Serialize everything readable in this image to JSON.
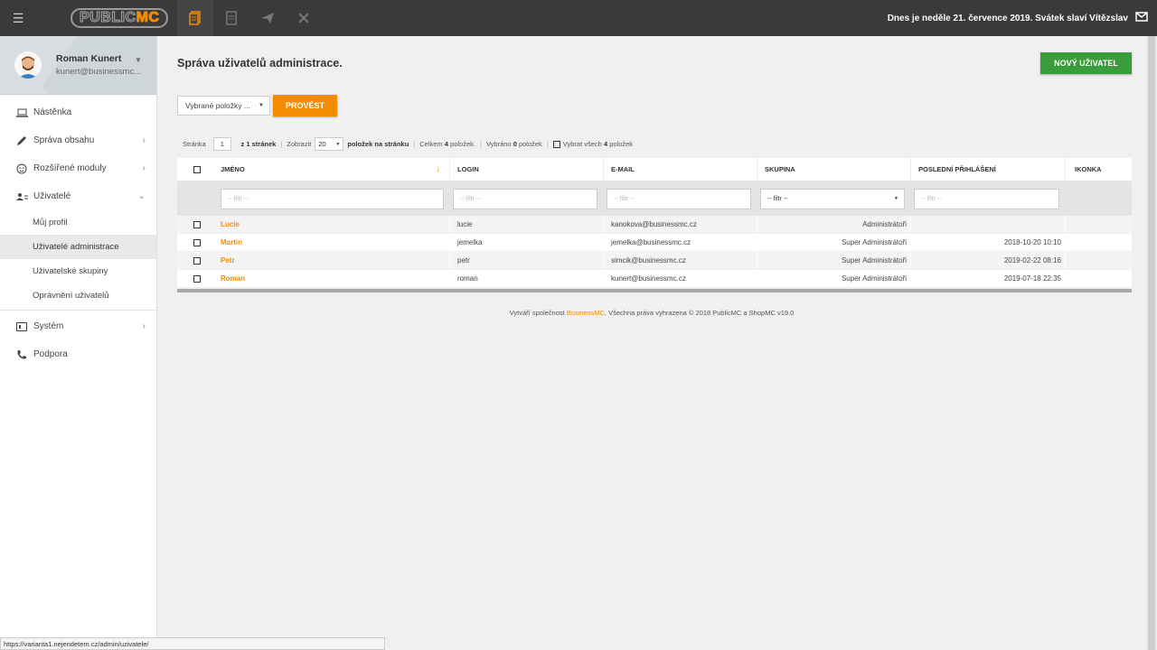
{
  "topbar": {
    "logo_left": "PUBLIC",
    "logo_right": "MC",
    "date_text": "Dnes je neděle 21. července 2019. Svátek slaví Vítězslav",
    "icons": [
      "menu-icon",
      "pages-icon",
      "document-icon",
      "send-icon",
      "tools-icon",
      "mail-icon"
    ]
  },
  "user": {
    "name": "Roman Kunert",
    "email": "kunert@businessmc..."
  },
  "sidebar": {
    "items": [
      {
        "label": "Nástěnka"
      },
      {
        "label": "Správa obsahu"
      },
      {
        "label": "Rozšířené moduly"
      },
      {
        "label": "Uživatelé"
      },
      {
        "label": "Systém"
      },
      {
        "label": "Podpora"
      }
    ],
    "subitems": [
      {
        "label": "Můj profil"
      },
      {
        "label": "Uživatelé administrace"
      },
      {
        "label": "Uživatelské skupiny"
      },
      {
        "label": "Oprávnění uživatelů"
      }
    ]
  },
  "main": {
    "title": "Správa uživatelů administrace.",
    "new_user_label": "NOVÝ UŽIVATEL",
    "bulk_select": "Vybrané položky ...",
    "run_label": "PROVÉST"
  },
  "pager": {
    "page_label": "Stránka",
    "page_value": "1",
    "of_pages": "z 1 stránek",
    "show_label": "Zobrazit",
    "per_page": "20",
    "per_page_suffix": "položek na stránku",
    "total_prefix": "Celkem",
    "total_count": "4",
    "total_suffix": "položek.",
    "selected_prefix": "Vybráno",
    "selected_count": "0",
    "selected_suffix": "položek",
    "select_all_prefix": "Vybrat všech",
    "select_all_count": "4",
    "select_all_suffix": "položek"
  },
  "table": {
    "headers": [
      "JMÉNO",
      "LOGIN",
      "E-MAIL",
      "SKUPINA",
      "POSLEDNÍ PŘIHLÁŠENÍ",
      "IKONKA"
    ],
    "filter_placeholder": "-- filtr --",
    "filter_select": "-- filtr --",
    "rows": [
      {
        "name": "Lucie",
        "login": "lucie",
        "email": "kanokova@businessmc.cz",
        "group": "Administrátoři",
        "last_login": ""
      },
      {
        "name": "Martin",
        "login": "jemelka",
        "email": "jemelka@businessmc.cz",
        "group": "Super Administrátoři",
        "last_login": "2018-10-20 10:10"
      },
      {
        "name": "Petr",
        "login": "petr",
        "email": "simcik@businessmc.cz",
        "group": "Super Administrátoři",
        "last_login": "2019-02-22 08:16"
      },
      {
        "name": "Roman",
        "login": "roman",
        "email": "kunert@businessmc.cz",
        "group": "Super Administrátoři",
        "last_login": "2019-07-18 22:35"
      }
    ]
  },
  "footer": {
    "prefix": "Vytváří společnost",
    "brand": "BusinessMC",
    "suffix": ". Všechna práva vyhrazena © 2018 PublicMC a ShopMC v19.0"
  },
  "status_url": "https://varianta1.nejendetem.cz/admin/uzivatele/",
  "colors": {
    "accent": "#f28c00",
    "topbar": "#3a3a3a",
    "success": "#3b9c3b"
  }
}
